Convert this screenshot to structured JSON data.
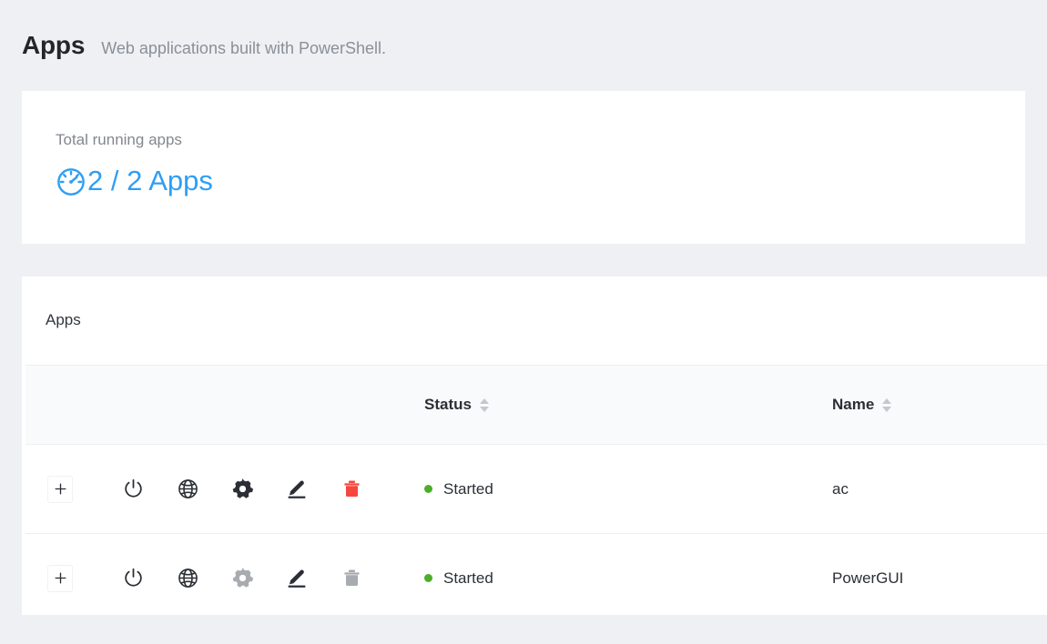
{
  "header": {
    "title": "Apps",
    "subtitle": "Web applications built with PowerShell."
  },
  "summary": {
    "label": "Total running apps",
    "value": "2 / 2 Apps",
    "icon": "gauge-icon",
    "accent_color": "#2f9ef4"
  },
  "table_card": {
    "title": "Apps",
    "columns": [
      {
        "key": "actions",
        "label": "",
        "sortable": false
      },
      {
        "key": "status",
        "label": "Status",
        "sortable": true
      },
      {
        "key": "name",
        "label": "Name",
        "sortable": true
      }
    ],
    "rows": [
      {
        "actions": [
          {
            "name": "add-icon",
            "enabled": true,
            "color": "#2b2f35"
          },
          {
            "name": "power-icon",
            "enabled": true,
            "color": "#2b2f35"
          },
          {
            "name": "globe-icon",
            "enabled": true,
            "color": "#2b2f35"
          },
          {
            "name": "gear-icon",
            "enabled": true,
            "color": "#2b2f35"
          },
          {
            "name": "edit-pencil-icon",
            "enabled": true,
            "color": "#2b2f35"
          },
          {
            "name": "trash-icon",
            "enabled": true,
            "color": "#f7463f"
          }
        ],
        "status": "Started",
        "status_color": "#4caf27",
        "name": "ac"
      },
      {
        "actions": [
          {
            "name": "add-icon",
            "enabled": true,
            "color": "#2b2f35"
          },
          {
            "name": "power-icon",
            "enabled": true,
            "color": "#2b2f35"
          },
          {
            "name": "globe-icon",
            "enabled": true,
            "color": "#2b2f35"
          },
          {
            "name": "gear-icon",
            "enabled": false,
            "color": "#a8abb0"
          },
          {
            "name": "edit-pencil-icon",
            "enabled": true,
            "color": "#2b2f35"
          },
          {
            "name": "trash-icon",
            "enabled": false,
            "color": "#a8abb0"
          }
        ],
        "status": "Started",
        "status_color": "#4caf27",
        "name": "PowerGUI"
      }
    ]
  }
}
